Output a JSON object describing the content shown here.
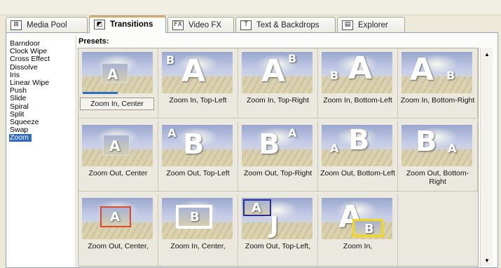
{
  "tabs": [
    {
      "label": "Media Pool",
      "icon": "media-pool-icon",
      "glyph": "⊞",
      "active": false
    },
    {
      "label": "Transitions",
      "icon": "transitions-icon",
      "glyph": "◩",
      "active": true
    },
    {
      "label": "Video FX",
      "icon": "video-fx-icon",
      "glyph": "FX",
      "active": false
    },
    {
      "label": "Text & Backdrops",
      "icon": "text-backdrops-icon",
      "glyph": "T",
      "active": false
    },
    {
      "label": "Explorer",
      "icon": "explorer-icon",
      "glyph": "▤",
      "active": false
    }
  ],
  "categories": [
    {
      "label": "Barndoor"
    },
    {
      "label": "Clock Wipe"
    },
    {
      "label": "Cross Effect"
    },
    {
      "label": "Dissolve"
    },
    {
      "label": "Iris"
    },
    {
      "label": "Linear Wipe"
    },
    {
      "label": "Push"
    },
    {
      "label": "Slide"
    },
    {
      "label": "Spiral"
    },
    {
      "label": "Split"
    },
    {
      "label": "Squeeze"
    },
    {
      "label": "Swap"
    },
    {
      "label": "Zoom",
      "selected": true
    }
  ],
  "presets_label": "Presets:",
  "presets": [
    {
      "caption": "Zoom In, Center",
      "selected": true
    },
    {
      "caption": "Zoom In, Top-Left"
    },
    {
      "caption": "Zoom In, Top-Right"
    },
    {
      "caption": "Zoom In, Bottom-Left"
    },
    {
      "caption": "Zoom In, Bottom-Right"
    },
    {
      "caption": "Zoom Out, Center"
    },
    {
      "caption": "Zoom Out, Top-Left"
    },
    {
      "caption": "Zoom Out, Top-Right"
    },
    {
      "caption": "Zoom Out, Bottom-Left"
    },
    {
      "caption": "Zoom Out, Bottom-Right"
    },
    {
      "caption": "Zoom Out, Center,"
    },
    {
      "caption": "Zoom In, Center,"
    },
    {
      "caption": "Zoom Out, Top-Left,"
    },
    {
      "caption": "Zoom In,"
    }
  ],
  "colors": {
    "selection": "#316ac5",
    "preset_red_frame": "#d94a2a",
    "preset_white_frame": "#ffffff",
    "preset_blue_frame": "#2a2f8f",
    "preset_yellow_frame": "#f2d81a"
  },
  "scrollbar": {
    "up_icon": "scroll-up-icon",
    "down_icon": "scroll-down-icon"
  }
}
